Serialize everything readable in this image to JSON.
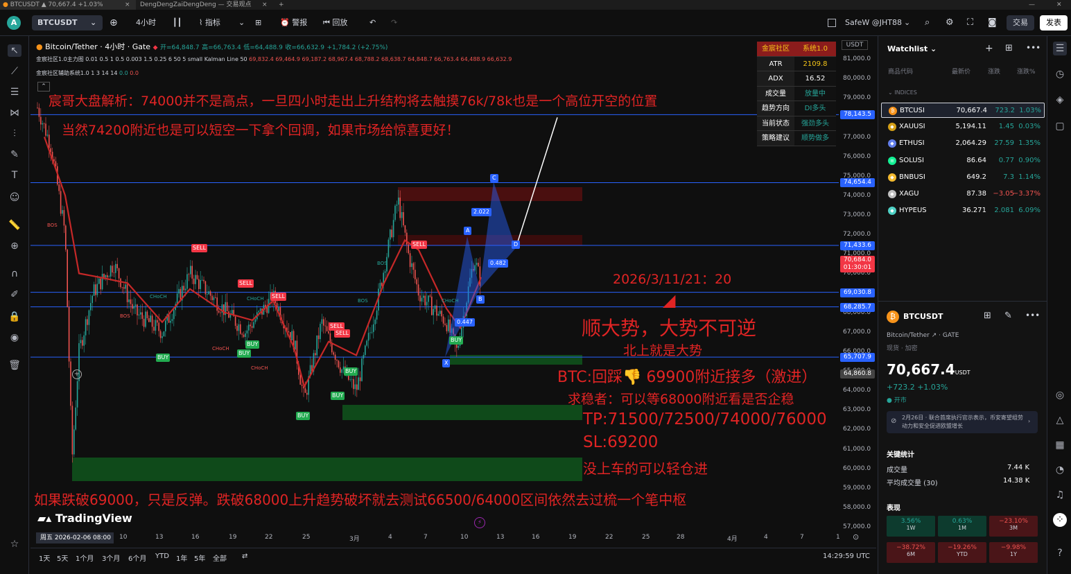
{
  "tabs": [
    {
      "label": "BTCUSDT ▲ 70,667.4 +1.03%"
    },
    {
      "label": "DengDengZaiDengDeng — 交易观点"
    }
  ],
  "toolbar": {
    "symbol": "BTCUSDT",
    "interval": "4小时",
    "indicators": "指标",
    "alerts": "警报",
    "replay": "回放",
    "account": "SafeW @JHT88",
    "trade": "交易",
    "publish": "发表"
  },
  "legend": {
    "title": "Bitcoin/Tether · 4小时 · Gate",
    "ohlc_open": "开=64,848.7",
    "ohlc_high": "高=66,763.4",
    "ohlc_low": "低=64,488.9",
    "ohlc_close": "收=66,632.9",
    "ohlc_change": "+1,784.2 (+2.75%)",
    "ind1": "金宸社区1.0主力图 0.01 0.5 1 0.5 0.003 1.5 0.25 6 50 5 small Kalman Line 50",
    "ind1_vals": "69,832.4  69,464.9  69,187.2  68,967.4  68,788.2  68,638.7  64,848.7  66,763.4  64,488.9  66,632.9",
    "ind2": "金宸社区辅助系统1.0 1 3 14 14",
    "ind2_v1": "0.0",
    "ind2_v2": "0.0"
  },
  "info_table": {
    "header_key": "金宸社区",
    "header_val": "系统1.0",
    "rows": [
      {
        "k": "ATR",
        "v": "2109.8",
        "color": "#f5c518"
      },
      {
        "k": "ADX",
        "v": "16.52",
        "color": "#ffffff"
      },
      {
        "k": "成交量",
        "v": "放量中",
        "color": "#26a69a"
      },
      {
        "k": "趋势方向",
        "v": "DI多头",
        "color": "#26a69a"
      },
      {
        "k": "当前状态",
        "v": "强劲多头",
        "color": "#26a69a"
      },
      {
        "k": "策略建议",
        "v": "顺势做多",
        "color": "#26a69a"
      }
    ]
  },
  "annotations": {
    "a1": "宸哥大盘解析：74000并不是高点，一旦四小时走出上升结构将去触摸76k/78k也是一个高位开空的位置",
    "a2": "当然74200附近也是可以短空一下拿个回调，如果市场给惊喜更好！",
    "date": "2026/3/11/21：20",
    "trend1": "顺大势，大势不可逆",
    "trend2": "北上就是大势",
    "btc": "BTC:回踩👎 69900附近接多（激进）",
    "steady": "求稳者：可以等68000附近看是否企稳",
    "tp": "TP:71500/72500/74000/76000",
    "sl": "SL:69200",
    "light": "没上车的可以轻仓进",
    "bottom": "如果跌破69000，只是反弹。跌破68000上升趋势破坏就去测试66500/64000区间依然去过梳一个笔中枢"
  },
  "waves": {
    "c": "C",
    "a": "A",
    "d": "D",
    "b": "B",
    "x": "X",
    "r1": "2.022",
    "r2": "0.482",
    "r3": "0.447"
  },
  "signals": {
    "sell": "SELL",
    "buy": "BUY",
    "bos": "BOS",
    "choch": "CHoCH"
  },
  "price_axis": {
    "currency": "USDT",
    "ticks": [
      "81,000.0",
      "80,000.0",
      "79,000.0",
      "78,000.0",
      "77,000.0",
      "76,000.0",
      "75,000.0",
      "74,000.0",
      "73,000.0",
      "72,000.0",
      "71,000.0",
      "70,000.0",
      "69,000.0",
      "68,000.0",
      "67,000.0",
      "66,000.0",
      "65,000.0",
      "64,000.0",
      "63,000.0",
      "62,000.0",
      "61,000.0",
      "60,000.0",
      "59,000.0",
      "58,000.0",
      "57,000.0"
    ],
    "labels": [
      {
        "text": "78,143.5",
        "color": "#2962ff",
        "price": 78143.5
      },
      {
        "text": "74,654.4",
        "color": "#2962ff",
        "price": 74654.4
      },
      {
        "text": "71,433.6",
        "color": "#2962ff",
        "price": 71433.6
      },
      {
        "text": "70,684.0",
        "color": "#f23645",
        "price": 70684.0
      },
      {
        "text": "01:30:01",
        "color": "#f23645",
        "price": 70300
      },
      {
        "text": "69,030.8",
        "color": "#2962ff",
        "price": 69030.8
      },
      {
        "text": "68,285.7",
        "color": "#2962ff",
        "price": 68285.7
      },
      {
        "text": "65,707.9",
        "color": "#2962ff",
        "price": 65707.9
      },
      {
        "text": "64,860.8",
        "color": "#444444",
        "price": 64860.8
      }
    ]
  },
  "time_axis": {
    "current": "周五 2026-02-06  08:00",
    "ticks": [
      "10",
      "13",
      "16",
      "19",
      "22",
      "25",
      "3月",
      "4",
      "7",
      "10",
      "13",
      "16",
      "19",
      "22",
      "25",
      "28",
      "4月",
      "4",
      "7",
      "1"
    ]
  },
  "bottom_bar": {
    "ranges": [
      "1天",
      "5天",
      "1个月",
      "3个月",
      "6个月",
      "YTD",
      "1年",
      "5年",
      "全部"
    ],
    "clock": "14:29:59 UTC"
  },
  "brand": "TradingView",
  "watchlist": {
    "title": "Watchlist",
    "col_symbol": "商品代码",
    "col_last": "最新价",
    "col_chg": "涨跌",
    "col_chgp": "涨跌%",
    "section": "INDICES",
    "rows": [
      {
        "sym": "BTCUSI",
        "last": "70,667.4",
        "chg": "723.2",
        "chgp": "1.03%",
        "dir": "up",
        "icon_color": "#f7931a",
        "icon": "₿"
      },
      {
        "sym": "XAUUSI",
        "last": "5,194.11",
        "chg": "1.45",
        "chgp": "0.03%",
        "dir": "up",
        "icon_color": "#d4a017",
        "icon": "◆"
      },
      {
        "sym": "ETHUSI",
        "last": "2,064.29",
        "chg": "27.59",
        "chgp": "1.35%",
        "dir": "up",
        "icon_color": "#627eea",
        "icon": "◆"
      },
      {
        "sym": "SOLUSI",
        "last": "86.64",
        "chg": "0.77",
        "chgp": "0.90%",
        "dir": "up",
        "icon_color": "#14f195",
        "icon": "≡"
      },
      {
        "sym": "BNBUSI",
        "last": "649.2",
        "chg": "7.3",
        "chgp": "1.14%",
        "dir": "up",
        "icon_color": "#f3ba2f",
        "icon": "◆"
      },
      {
        "sym": "XAGU",
        "last": "87.38",
        "chg": "−3.05",
        "chgp": "−3.37%",
        "dir": "dn",
        "icon_color": "#c0c0c0",
        "icon": "◆"
      },
      {
        "sym": "HYPEUS",
        "last": "36.271",
        "chg": "2.081",
        "chgp": "6.09%",
        "dir": "up",
        "icon_color": "#4fd1c5",
        "icon": "◆"
      }
    ]
  },
  "detail": {
    "symbol": "BTCUSDT",
    "name": "Bitcoin/Tether",
    "exchange": "GATE",
    "spot": "现货",
    "crypto": "加密",
    "price": "70,667.4",
    "currency": "USDT",
    "change": "+723.2  +1.03%",
    "status": "开市",
    "news": "2月26日 · 联合首席执行官示表示，币安寄望组劳动力和安全促进欧盟增长",
    "stats_title": "关键统计",
    "vol_label": "成交量",
    "vol_value": "7.44 K",
    "avgvol_label": "平均成交量 (30)",
    "avgvol_value": "14.38 K",
    "perf_title": "表现",
    "perf": [
      {
        "v": "3.56%",
        "p": "1W",
        "dir": "up"
      },
      {
        "v": "0.63%",
        "p": "1M",
        "dir": "up"
      },
      {
        "v": "−23.10%",
        "p": "3M",
        "dir": "dn"
      },
      {
        "v": "−38.72%",
        "p": "6M",
        "dir": "dn"
      },
      {
        "v": "−19.26%",
        "p": "YTD",
        "dir": "dn"
      },
      {
        "v": "−9.98%",
        "p": "1Y",
        "dir": "dn"
      }
    ]
  }
}
